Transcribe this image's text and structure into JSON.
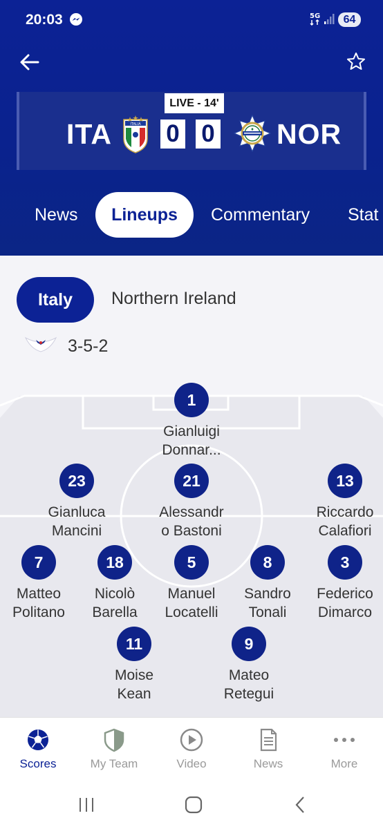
{
  "status_bar": {
    "time": "20:03",
    "network": "5G",
    "battery": "64"
  },
  "match": {
    "status": "LIVE - 14'",
    "home_team": "ITA",
    "away_team": "NOR",
    "home_score": "0",
    "away_score": "0"
  },
  "tabs": [
    {
      "label": "News"
    },
    {
      "label": "Lineups"
    },
    {
      "label": "Commentary"
    },
    {
      "label": "Stat"
    }
  ],
  "lineup": {
    "teams": [
      "Italy",
      "Northern Ireland"
    ],
    "selected_team": "Italy",
    "formation": "3-5-2",
    "players": [
      {
        "number": "1",
        "name_line1": "Gianluigi",
        "name_line2": "Donnar..."
      },
      {
        "number": "23",
        "name_line1": "Gianluca",
        "name_line2": "Mancini"
      },
      {
        "number": "21",
        "name_line1": "Alessandr",
        "name_line2": "o Bastoni"
      },
      {
        "number": "13",
        "name_line1": "Riccardo",
        "name_line2": "Calafiori"
      },
      {
        "number": "7",
        "name_line1": "Matteo",
        "name_line2": "Politano"
      },
      {
        "number": "18",
        "name_line1": "Nicolò",
        "name_line2": "Barella"
      },
      {
        "number": "5",
        "name_line1": "Manuel",
        "name_line2": "Locatelli"
      },
      {
        "number": "8",
        "name_line1": "Sandro",
        "name_line2": "Tonali"
      },
      {
        "number": "3",
        "name_line1": "Federico",
        "name_line2": "Dimarco"
      },
      {
        "number": "11",
        "name_line1": "Moise",
        "name_line2": "Kean"
      },
      {
        "number": "9",
        "name_line1": "Mateo",
        "name_line2": "Retegui"
      }
    ]
  },
  "bottom_nav": [
    {
      "label": "Scores",
      "icon": "football-icon",
      "active": true
    },
    {
      "label": "My Team",
      "icon": "shield-icon",
      "active": false
    },
    {
      "label": "Video",
      "icon": "play-icon",
      "active": false
    },
    {
      "label": "News",
      "icon": "document-icon",
      "active": false
    },
    {
      "label": "More",
      "icon": "more-dots-icon",
      "active": false
    }
  ],
  "colors": {
    "brand_blue": "#0c2295",
    "inactive_gray": "#9a9a9a"
  }
}
